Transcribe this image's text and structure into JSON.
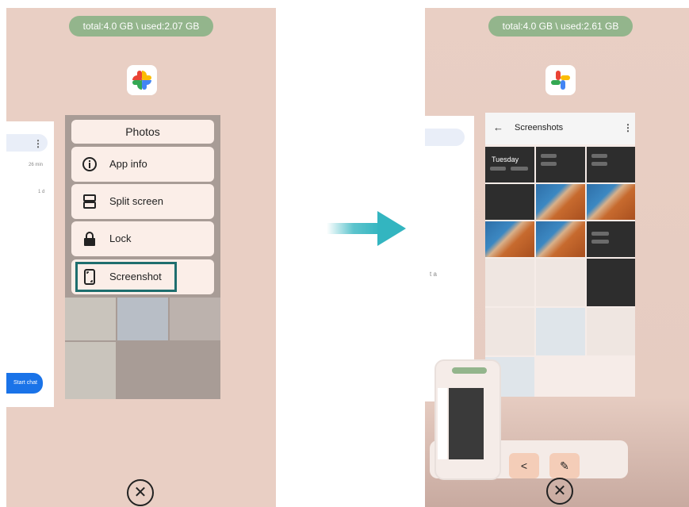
{
  "left_screen": {
    "memory_label": "total:4.0 GB \\ used:2.07 GB",
    "app_icon": "google-photos-pinwheel-icon",
    "side_card": {
      "time_label_1": "26 min",
      "time_label_2": "1 d",
      "start_chat": "Start chat"
    },
    "menu": {
      "title": "Photos",
      "items": [
        {
          "label": "App info",
          "icon": "info-icon"
        },
        {
          "label": "Split screen",
          "icon": "split-screen-icon"
        },
        {
          "label": "Lock",
          "icon": "lock-icon"
        },
        {
          "label": "Screenshot",
          "icon": "screenshot-icon",
          "highlighted": true
        }
      ]
    },
    "close_icon": "close-icon"
  },
  "arrow": {
    "icon": "right-arrow-icon",
    "color": "#33b5c0"
  },
  "right_screen": {
    "memory_label": "total:4.0 GB \\ used:2.61 GB",
    "app_icon": "google-photos-pinwheel-icon",
    "album": {
      "back_icon": "back-arrow-icon",
      "title": "Screenshots",
      "section_label": "Tuesday",
      "menu_icon": "more-vert-icon"
    },
    "side_card": {
      "text_1": "t a"
    },
    "preview": {
      "share_icon": "share-icon",
      "edit_icon": "edit-pencil-icon"
    },
    "close_icon": "close-icon"
  },
  "colors": {
    "background": "#e9cfc4",
    "memory_pill": "#93b58c",
    "menu_bg": "#fbeee8",
    "highlight_border": "#1e6e6e",
    "accent_blue": "#1a73e8",
    "action_button": "#f4cdb8"
  }
}
